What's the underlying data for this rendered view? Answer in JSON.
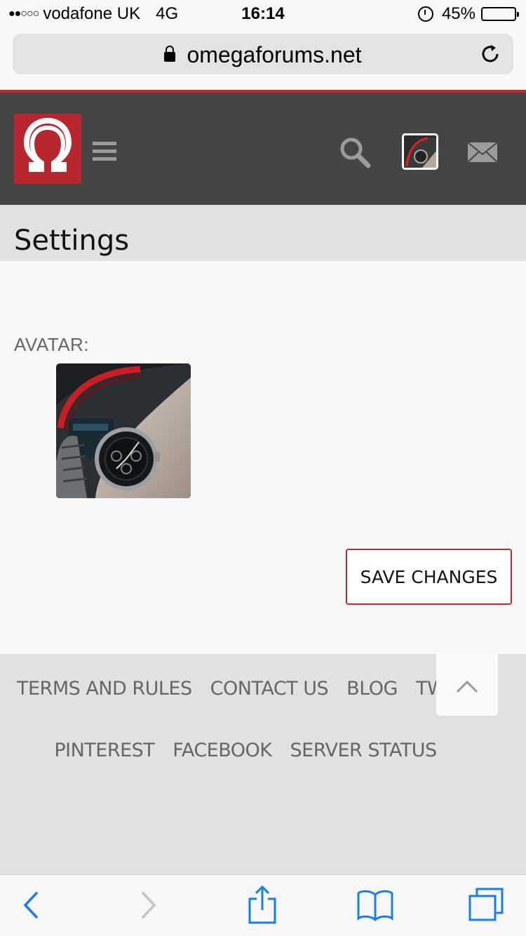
{
  "status_bar": {
    "signal": "●●○○○",
    "carrier": "vodafone UK",
    "network": "4G",
    "time": "16:14",
    "battery": "45%",
    "battery_level": 0.45
  },
  "browser": {
    "url": "omegaforums.net"
  },
  "header": {
    "logo_icon": "omega-logo",
    "accent_color": "#c0272d",
    "header_bg": "#454545"
  },
  "page": {
    "title": "Settings",
    "avatar_label": "AVATAR:",
    "save_label": "SAVE CHANGES"
  },
  "footer": {
    "links_row1": [
      "TERMS AND RULES",
      "CONTACT US",
      "BLOG",
      "TWITTER"
    ],
    "links_row2": [
      "PINTEREST",
      "FACEBOOK",
      "SERVER STATUS"
    ]
  },
  "toolbar": {
    "icons": [
      "back-icon",
      "forward-icon",
      "share-icon",
      "bookmarks-icon",
      "tabs-icon"
    ]
  }
}
